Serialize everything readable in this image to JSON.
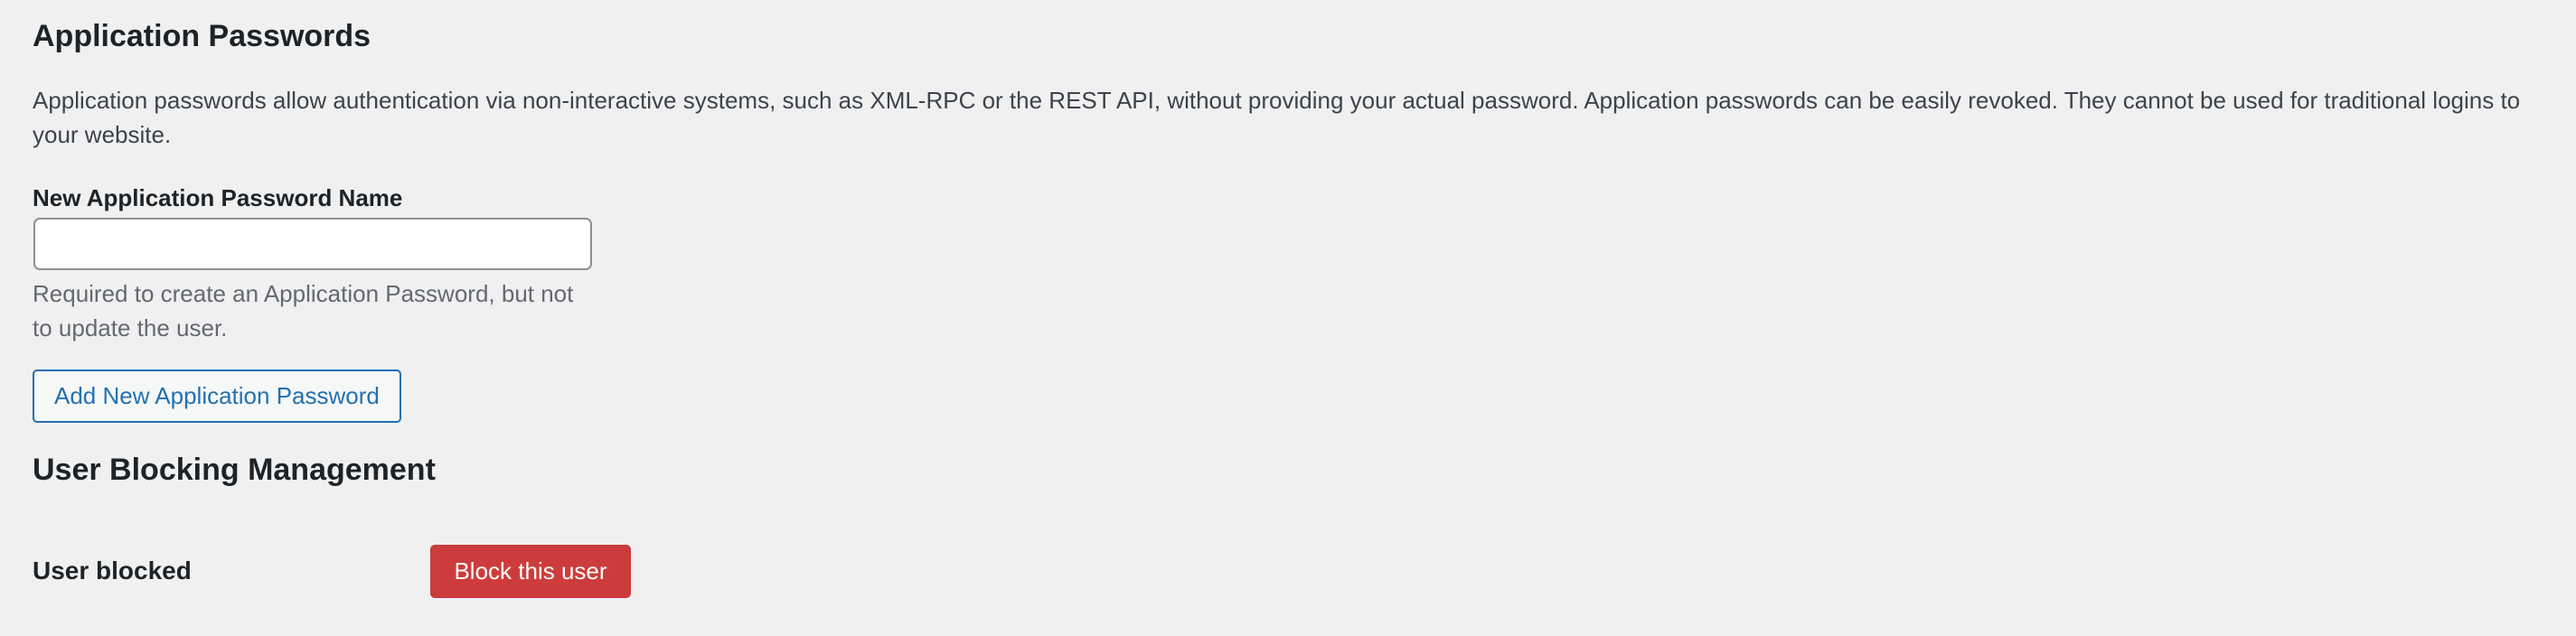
{
  "application_passwords": {
    "title": "Application Passwords",
    "description": "Application passwords allow authentication via non-interactive systems, such as XML-RPC or the REST API, without providing your actual password. Application passwords can be easily revoked. They cannot be used for traditional logins to your website.",
    "name_field": {
      "label": "New Application Password Name",
      "value": "",
      "help": "Required to create an Application Password, but not to update the user."
    },
    "add_button_label": "Add New Application Password"
  },
  "user_blocking": {
    "title": "User Blocking Management",
    "row_label": "User blocked",
    "block_button_label": "Block this user"
  },
  "colors": {
    "background": "#f0f0f1",
    "primary_blue": "#2271b1",
    "danger_red": "#cd3c3c"
  }
}
